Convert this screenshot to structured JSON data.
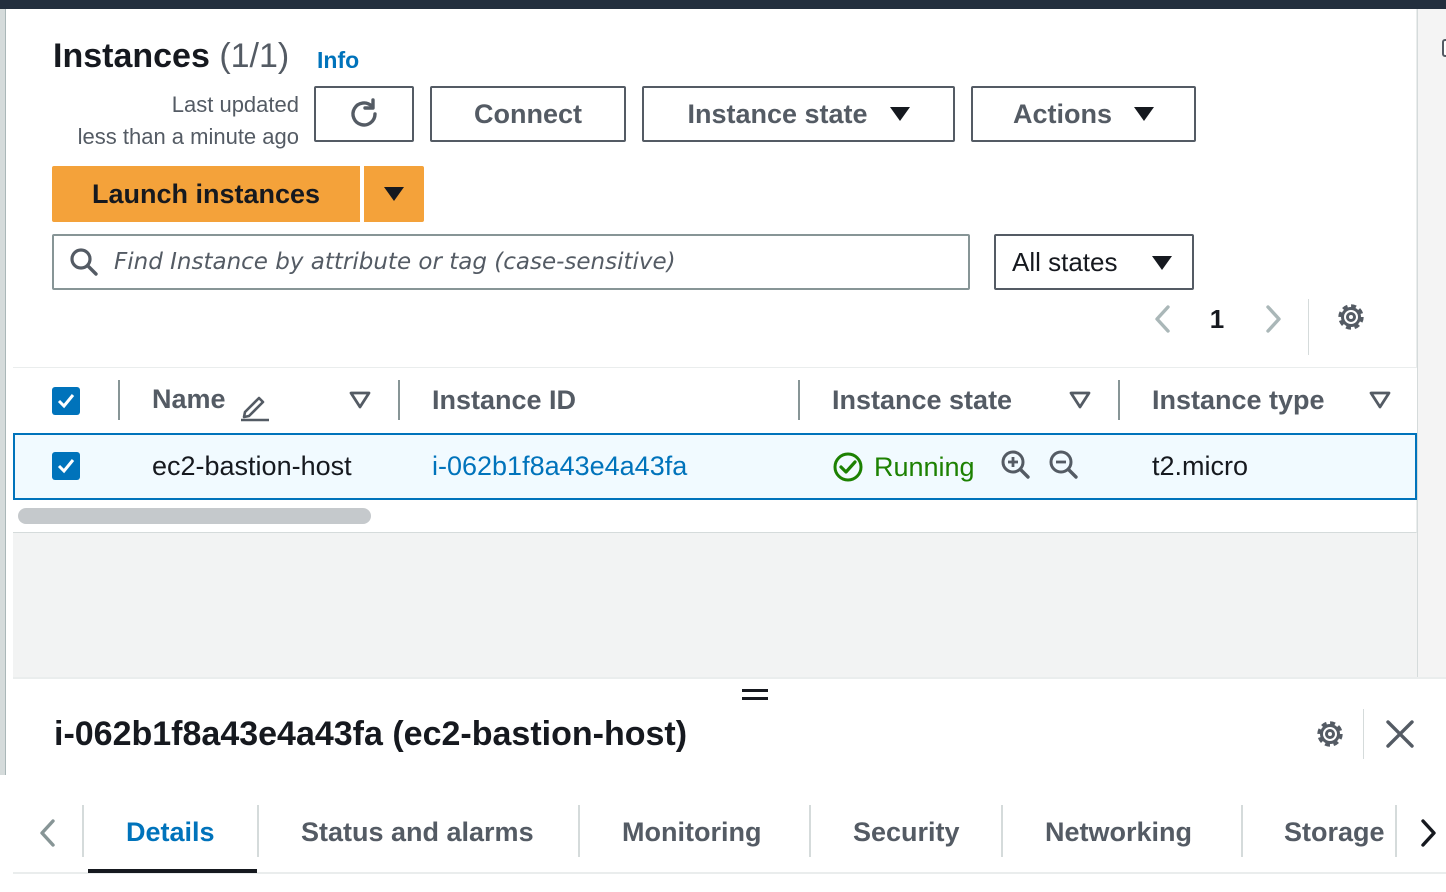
{
  "header": {
    "title": "Instances",
    "count": "(1/1)",
    "info": "Info",
    "last_updated_line1": "Last updated",
    "last_updated_line2": "less than a minute ago"
  },
  "toolbar": {
    "connect": "Connect",
    "instance_state": "Instance state",
    "actions": "Actions",
    "launch": "Launch instances"
  },
  "search": {
    "placeholder": "Find Instance by attribute or tag (case-sensitive)",
    "value": ""
  },
  "filter": {
    "selected": "All states"
  },
  "pagination": {
    "page": "1"
  },
  "table": {
    "columns": [
      "Name",
      "Instance ID",
      "Instance state",
      "Instance type"
    ],
    "rows": [
      {
        "selected": true,
        "name": "ec2-bastion-host",
        "instance_id": "i-062b1f8a43e4a43fa",
        "state": "Running",
        "type": "t2.micro"
      }
    ]
  },
  "detail": {
    "title": "i-062b1f8a43e4a43fa (ec2-bastion-host)",
    "tabs": [
      "Details",
      "Status and alarms",
      "Monitoring",
      "Security",
      "Networking",
      "Storage"
    ],
    "active_tab": "Details"
  },
  "colors": {
    "primary": "#f4a23a",
    "link": "#0073bb",
    "running": "#1d8102",
    "header": "#232f3e"
  }
}
